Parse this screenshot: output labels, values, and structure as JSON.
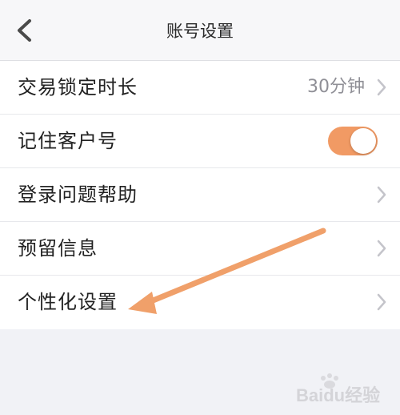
{
  "nav": {
    "title": "账号设置",
    "back_icon": "chevron-left-icon"
  },
  "rows": [
    {
      "label": "交易锁定时长",
      "value": "30分钟",
      "control": "chevron"
    },
    {
      "label": "记住客户号",
      "control": "toggle",
      "toggle_on": true
    },
    {
      "label": "登录问题帮助",
      "control": "chevron"
    },
    {
      "label": "预留信息",
      "control": "chevron"
    },
    {
      "label": "个性化设置",
      "control": "chevron"
    }
  ],
  "annotation": {
    "type": "arrow",
    "points_to": "个性化设置",
    "color": "#f0a06a"
  },
  "watermark": {
    "text": "Baidu经验",
    "icon": "paw-icon"
  },
  "colors": {
    "accent": "#f19a64",
    "page_bg": "#f1f2f6",
    "list_bg": "#ffffff",
    "chevron": "#c4c4ca"
  }
}
